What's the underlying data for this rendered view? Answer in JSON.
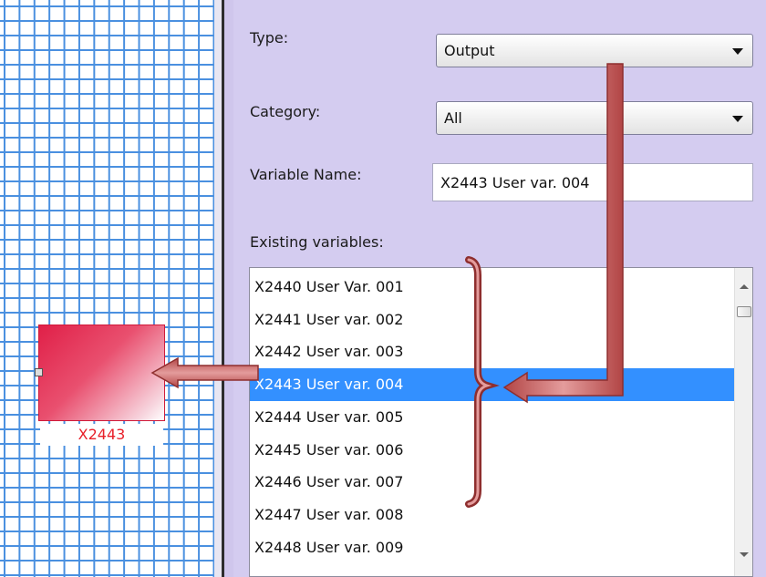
{
  "canvas": {
    "block": {
      "label": "X2443"
    }
  },
  "form": {
    "type": {
      "label": "Type:",
      "value": "Output"
    },
    "category": {
      "label": "Category:",
      "value": "All"
    },
    "variable_name": {
      "label": "Variable Name:",
      "value": "X2443 User var. 004"
    },
    "existing": {
      "label": "Existing variables:",
      "items": [
        "X2440 User Var. 001",
        "X2441 User var. 002",
        "X2442 User var. 003",
        "X2443 User var. 004",
        "X2444 User var. 005",
        "X2445 User var. 006",
        "X2446 User var. 007",
        "X2447 User var. 008",
        "X2448 User var. 009"
      ],
      "selected_index": 3
    }
  },
  "colors": {
    "grid": "#4a90e0",
    "panel": "#d4ccf0",
    "selection": "#3390ff",
    "block": "#e02048",
    "annotation_arrow": "#c25a5a"
  },
  "icons": {
    "combo_arrow": "triangle-down",
    "scroll_up": "triangle-up",
    "scroll_down": "triangle-down"
  }
}
